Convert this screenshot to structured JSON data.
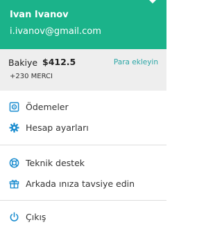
{
  "user": {
    "name": "Ivan Ivanov",
    "email": "i.ivanov@gmail.com"
  },
  "balance": {
    "label": "Bakiye",
    "amount": "$412.5",
    "add_link": "Para ekleyin",
    "points": "+230 MERCI"
  },
  "menu": {
    "payments": "Ödemeler",
    "account_settings": "Hesap ayarları",
    "support": "Teknik destek",
    "invite": "Arkada  ınıza tavsiye edin",
    "logout": "Çıkış"
  },
  "colors": {
    "header": "#1bb38a",
    "icon": "#1a8ccf",
    "link": "#2ba6a6"
  }
}
